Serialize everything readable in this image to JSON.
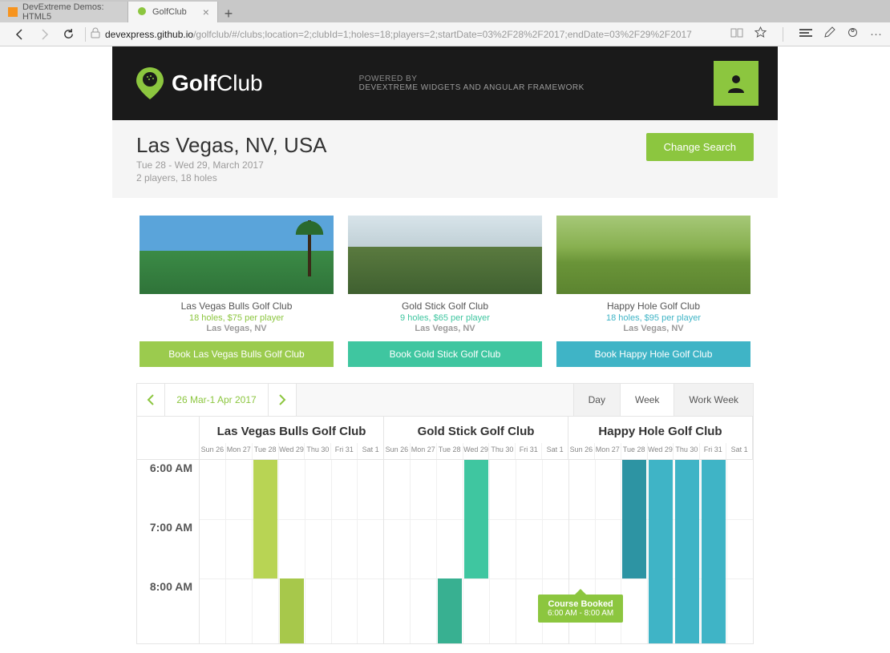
{
  "browser": {
    "tabs": [
      {
        "label": "DevExtreme Demos: HTML5",
        "active": false
      },
      {
        "label": "GolfClub",
        "active": true
      }
    ],
    "url_host": "devexpress.github.io",
    "url_path": "/golfclub/#/clubs;location=2;clubId=1;holes=18;players=2;startDate=03%2F28%2F2017;endDate=03%2F29%2F2017"
  },
  "header": {
    "brand_bold": "Golf",
    "brand_light": "Club",
    "powered_label": "POWERED BY",
    "powered_text": "DEVEXTREME WIDGETS AND ANGULAR FRAMEWORK"
  },
  "search": {
    "location": "Las Vegas, NV, USA",
    "dates": "Tue 28 - Wed 29, March 2017",
    "details": "2 players, 18 holes",
    "change_label": "Change Search"
  },
  "clubs": [
    {
      "name": "Las Vegas Bulls Golf Club",
      "info": "18 holes, $75 per player",
      "city": "Las Vegas, NV",
      "book_label": "Book Las Vegas Bulls Golf Club",
      "theme": "green"
    },
    {
      "name": "Gold Stick Golf Club",
      "info": "9 holes, $65 per player",
      "city": "Las Vegas, NV",
      "book_label": "Book Gold Stick Golf Club",
      "theme": "teal"
    },
    {
      "name": "Happy Hole Golf Club",
      "info": "18 holes, $95 per player",
      "city": "Las Vegas, NV",
      "book_label": "Book Happy Hole Golf Club",
      "theme": "blue"
    }
  ],
  "calendar": {
    "date_range": "26 Mar-1 Apr 2017",
    "views": [
      "Day",
      "Week",
      "Work Week"
    ],
    "active_view": "Week",
    "groups": [
      "Las Vegas Bulls Golf Club",
      "Gold Stick Golf Club",
      "Happy Hole Golf Club"
    ],
    "days": [
      "Sun 26",
      "Mon 27",
      "Tue 28",
      "Wed 29",
      "Thu 30",
      "Fri 31",
      "Sat 1"
    ],
    "hours": [
      "6:00 AM",
      "7:00 AM",
      "8:00 AM"
    ],
    "tooltip": {
      "title": "Course Booked",
      "time": "6:00 AM - 8:00 AM"
    }
  }
}
